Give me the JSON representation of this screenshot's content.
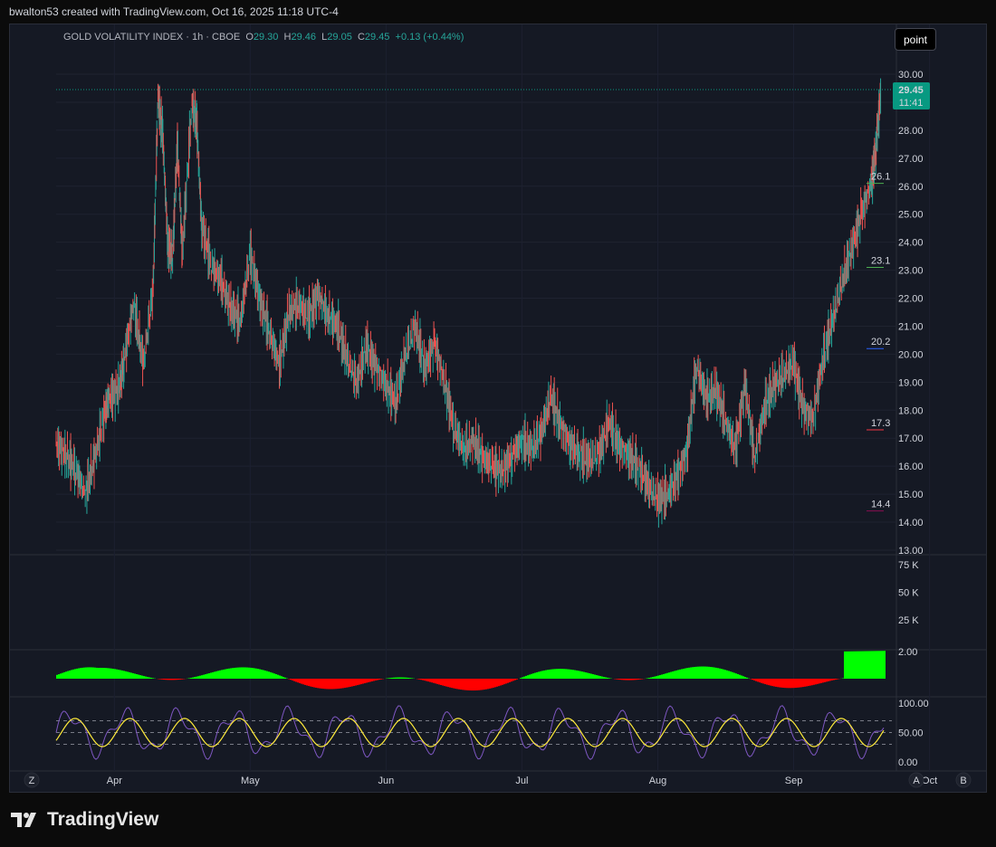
{
  "header": {
    "text": "bwalton53 created with TradingView.com, Oct 16, 2025 11:18 UTC-4"
  },
  "symbol": {
    "name": "GOLD VOLATILITY INDEX · 1h · CBOE",
    "o_label": "O",
    "o": "29.30",
    "h_label": "H",
    "h": "29.46",
    "l_label": "L",
    "l": "29.05",
    "c_label": "C",
    "c": "29.45",
    "change": "+0.13 (+0.44%)"
  },
  "toolbar": {
    "point_label": "point"
  },
  "last_price": {
    "value": "29.45",
    "time": "11:41",
    "color": "#089981"
  },
  "footer": {
    "brand": "TradingView"
  },
  "bottom_buttons": {
    "z": "Z",
    "a": "A",
    "b": "B"
  },
  "chart_data": {
    "type": "line",
    "title": "GOLD VOLATILITY INDEX · 1h · CBOE",
    "price_axis": {
      "ylim": [
        13,
        30
      ],
      "ticks": [
        "30.00",
        "29.00",
        "28.00",
        "27.00",
        "26.00",
        "25.00",
        "24.00",
        "23.00",
        "22.00",
        "21.00",
        "20.00",
        "19.00",
        "18.00",
        "17.00",
        "16.00",
        "15.00",
        "14.00",
        "13.00"
      ]
    },
    "x_months": [
      "Apr",
      "May",
      "Jun",
      "Jul",
      "Aug",
      "Sep",
      "Oct"
    ],
    "x_month_index": [
      0.06,
      0.2,
      0.34,
      0.48,
      0.62,
      0.76,
      0.9
    ],
    "price_series": [
      {
        "t": 0.0,
        "v": 16.8
      },
      {
        "t": 0.01,
        "v": 16.4
      },
      {
        "t": 0.02,
        "v": 15.9
      },
      {
        "t": 0.03,
        "v": 15.0
      },
      {
        "t": 0.04,
        "v": 16.3
      },
      {
        "t": 0.05,
        "v": 17.9
      },
      {
        "t": 0.055,
        "v": 18.4
      },
      {
        "t": 0.065,
        "v": 18.8
      },
      {
        "t": 0.07,
        "v": 19.8
      },
      {
        "t": 0.08,
        "v": 21.8
      },
      {
        "t": 0.09,
        "v": 19.6
      },
      {
        "t": 0.1,
        "v": 22.4
      },
      {
        "t": 0.105,
        "v": 29.2
      },
      {
        "t": 0.11,
        "v": 27.8
      },
      {
        "t": 0.115,
        "v": 24.0
      },
      {
        "t": 0.12,
        "v": 23.5
      },
      {
        "t": 0.125,
        "v": 27.5
      },
      {
        "t": 0.13,
        "v": 23.6
      },
      {
        "t": 0.14,
        "v": 29.0
      },
      {
        "t": 0.145,
        "v": 28.2
      },
      {
        "t": 0.15,
        "v": 24.6
      },
      {
        "t": 0.16,
        "v": 23.2
      },
      {
        "t": 0.17,
        "v": 22.6
      },
      {
        "t": 0.18,
        "v": 21.6
      },
      {
        "t": 0.19,
        "v": 21.2
      },
      {
        "t": 0.2,
        "v": 23.6
      },
      {
        "t": 0.21,
        "v": 21.9
      },
      {
        "t": 0.22,
        "v": 20.8
      },
      {
        "t": 0.23,
        "v": 19.6
      },
      {
        "t": 0.24,
        "v": 21.5
      },
      {
        "t": 0.25,
        "v": 21.8
      },
      {
        "t": 0.26,
        "v": 21.3
      },
      {
        "t": 0.27,
        "v": 22.1
      },
      {
        "t": 0.28,
        "v": 21.4
      },
      {
        "t": 0.29,
        "v": 21.0
      },
      {
        "t": 0.3,
        "v": 19.8
      },
      {
        "t": 0.31,
        "v": 19.0
      },
      {
        "t": 0.32,
        "v": 20.3
      },
      {
        "t": 0.33,
        "v": 19.5
      },
      {
        "t": 0.34,
        "v": 18.9
      },
      {
        "t": 0.35,
        "v": 18.3
      },
      {
        "t": 0.36,
        "v": 20.0
      },
      {
        "t": 0.37,
        "v": 21.0
      },
      {
        "t": 0.38,
        "v": 19.5
      },
      {
        "t": 0.39,
        "v": 20.4
      },
      {
        "t": 0.4,
        "v": 19.0
      },
      {
        "t": 0.41,
        "v": 17.4
      },
      {
        "t": 0.42,
        "v": 16.6
      },
      {
        "t": 0.43,
        "v": 16.9
      },
      {
        "t": 0.44,
        "v": 16.3
      },
      {
        "t": 0.45,
        "v": 16.0
      },
      {
        "t": 0.46,
        "v": 15.8
      },
      {
        "t": 0.47,
        "v": 16.4
      },
      {
        "t": 0.48,
        "v": 16.9
      },
      {
        "t": 0.49,
        "v": 16.6
      },
      {
        "t": 0.5,
        "v": 17.2
      },
      {
        "t": 0.51,
        "v": 18.5
      },
      {
        "t": 0.52,
        "v": 17.4
      },
      {
        "t": 0.53,
        "v": 16.8
      },
      {
        "t": 0.54,
        "v": 16.4
      },
      {
        "t": 0.55,
        "v": 16.2
      },
      {
        "t": 0.56,
        "v": 16.5
      },
      {
        "t": 0.57,
        "v": 17.6
      },
      {
        "t": 0.58,
        "v": 16.7
      },
      {
        "t": 0.59,
        "v": 16.4
      },
      {
        "t": 0.6,
        "v": 16.0
      },
      {
        "t": 0.61,
        "v": 15.3
      },
      {
        "t": 0.62,
        "v": 14.8
      },
      {
        "t": 0.63,
        "v": 15.0
      },
      {
        "t": 0.64,
        "v": 15.6
      },
      {
        "t": 0.65,
        "v": 16.5
      },
      {
        "t": 0.66,
        "v": 19.6
      },
      {
        "t": 0.67,
        "v": 18.4
      },
      {
        "t": 0.68,
        "v": 18.7
      },
      {
        "t": 0.69,
        "v": 17.6
      },
      {
        "t": 0.7,
        "v": 16.6
      },
      {
        "t": 0.71,
        "v": 18.9
      },
      {
        "t": 0.72,
        "v": 16.3
      },
      {
        "t": 0.73,
        "v": 18.1
      },
      {
        "t": 0.74,
        "v": 18.9
      },
      {
        "t": 0.75,
        "v": 19.3
      },
      {
        "t": 0.76,
        "v": 19.7
      },
      {
        "t": 0.77,
        "v": 18.0
      },
      {
        "t": 0.78,
        "v": 17.7
      },
      {
        "t": 0.79,
        "v": 19.8
      },
      {
        "t": 0.8,
        "v": 21.2
      },
      {
        "t": 0.81,
        "v": 22.6
      },
      {
        "t": 0.82,
        "v": 23.8
      },
      {
        "t": 0.83,
        "v": 25.0
      },
      {
        "t": 0.84,
        "v": 26.1
      },
      {
        "t": 0.845,
        "v": 27.4
      },
      {
        "t": 0.85,
        "v": 29.45
      }
    ],
    "levels": [
      {
        "label": "26.1",
        "value": 26.1,
        "color": "#4caf50"
      },
      {
        "label": "23.1",
        "value": 23.1,
        "color": "#4caf50"
      },
      {
        "label": "20.2",
        "value": 20.2,
        "color": "#2962ff"
      },
      {
        "label": "17.3",
        "value": 17.3,
        "color": "#f23645"
      },
      {
        "label": "14.4",
        "value": 14.4,
        "color": "#880e4f"
      }
    ],
    "volume_axis": {
      "ticks": [
        "75 K",
        "50 K",
        "25 K"
      ]
    },
    "histogram_axis": {
      "ticks": [
        "2.00"
      ]
    },
    "oscillator_axis": {
      "ylim": [
        0,
        100
      ],
      "ticks": [
        "100.00",
        "50.00",
        "0.00"
      ],
      "bands": [
        70,
        50,
        30
      ]
    },
    "colors": {
      "up": "#26a69a",
      "down": "#ef5350",
      "hist_up": "#00ff00",
      "hist_down": "#ff0000",
      "osc": "#7e57c2",
      "signal": "#ffeb3b"
    }
  }
}
